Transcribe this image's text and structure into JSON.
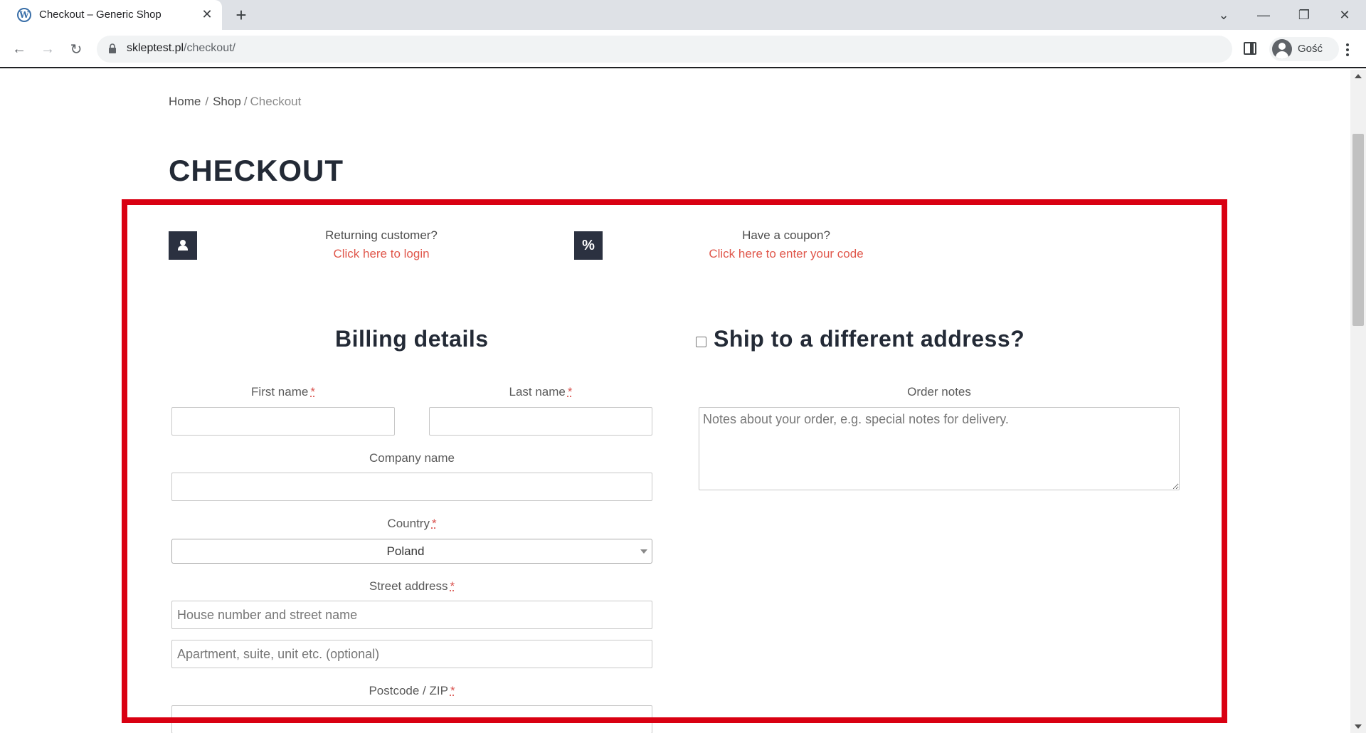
{
  "browser": {
    "tab_title": "Checkout – Generic Shop",
    "favicon": "W",
    "url_domain": "skleptest.pl",
    "url_path": "/checkout/",
    "profile_name": "Gość"
  },
  "breadcrumb": {
    "home": "Home",
    "shop": "Shop",
    "current": "Checkout",
    "separator": "/"
  },
  "page_title": "CHECKOUT",
  "notices": {
    "returning_customer": "Returning customer?",
    "login_link": "Click here to login",
    "coupon_question": "Have a coupon?",
    "coupon_link": "Click here to enter your code",
    "coupon_glyph": "%"
  },
  "billing": {
    "heading": "Billing details",
    "first_name_label": "First name",
    "last_name_label": "Last name",
    "company_label": "Company name",
    "country_label": "Country",
    "country_value": "Poland",
    "street_label": "Street address",
    "street_placeholder_1": "House number and street name",
    "street_placeholder_2": "Apartment, suite, unit etc. (optional)",
    "postcode_label": "Postcode / ZIP",
    "required_mark": "*"
  },
  "shipping": {
    "heading": "Ship to a different address?",
    "order_notes_label": "Order notes",
    "order_notes_placeholder": "Notes about your order, e.g. special notes for delivery."
  },
  "colors": {
    "link": "#e0574b",
    "heading": "#232a36",
    "icon_bg": "#2b3140",
    "highlight": "#d90012"
  }
}
